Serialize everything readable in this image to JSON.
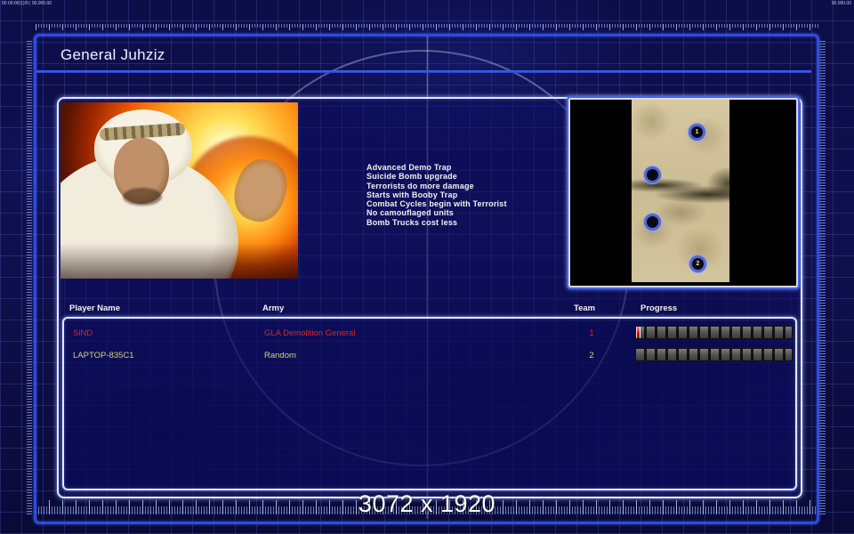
{
  "debug": {
    "left": "00 00:00(1)/0 | 00.000.00",
    "right": "00.000.00"
  },
  "header": {
    "title": "General Juhziz"
  },
  "general": {
    "abilities": [
      "Advanced Demo Trap",
      "Suicide Bomb upgrade",
      "Terrorists do more damage",
      "Starts with Booby Trap",
      "Combat Cycles begin with Terrorist",
      "No camouflaged units",
      "Bomb Trucks cost less"
    ]
  },
  "map_preview": {
    "markers": [
      {
        "label": "1"
      },
      {
        "label": ""
      },
      {
        "label": ""
      },
      {
        "label": "2"
      }
    ]
  },
  "table": {
    "columns": [
      "Player Name",
      "Army",
      "Team",
      "Progress"
    ],
    "players": [
      {
        "name": "SiND",
        "army": "GLA Demolition General",
        "team": "1",
        "color": "#cf2a2a",
        "progress_percent": 2
      },
      {
        "name": "LAPTOP-835C1",
        "army": "Random",
        "team": "2",
        "color": "#d3d37a",
        "progress_percent": 0
      }
    ]
  },
  "footer": {
    "resolution": "3072 x 1920"
  },
  "colors": {
    "frame_blue": "#2d4ce0",
    "panel_border": "#e2e9ff",
    "background": "#0d0d48",
    "player1_text": "#cf2a2a",
    "player2_text": "#d3d37a",
    "progress_fill_red": "#d01a1a"
  }
}
